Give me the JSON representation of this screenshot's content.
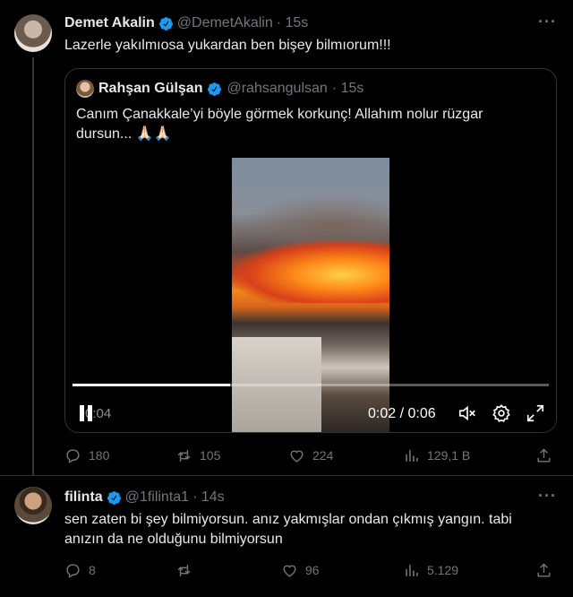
{
  "tweet1": {
    "author_name": "Demet Akalin",
    "handle": "@DemetAkalin",
    "time": "· 15s",
    "more": "···",
    "text": "Lazerle yakılmıosa yukardan ben bişey bilmıorum!!!",
    "quote": {
      "author_name": "Rahşan Gülşan",
      "handle": "@rahsangulsan",
      "time": "· 15s",
      "text": "Canım Çanakkale’yi böyle görmek korkunç! Allahım nolur rüzgar dursun... 🙏🏻🙏🏻",
      "video": {
        "current_time": "0:02 / 0:06",
        "left_time": "0:04",
        "progress": 0.33
      }
    },
    "actions": {
      "replies": "180",
      "retweets": "105",
      "likes": "224",
      "views": "129,1 B"
    }
  },
  "tweet2": {
    "author_name": "filinta",
    "handle": "@1filinta1",
    "time": "· 14s",
    "more": "···",
    "text": "sen zaten bi şey bilmiyorsun. anız yakmışlar ondan çıkmış yangın. tabi anızın da ne olduğunu bilmiyorsun",
    "actions": {
      "replies": "8",
      "retweets": "",
      "likes": "96",
      "views": "5.129"
    }
  },
  "colors": {
    "verified": "#1d9bf0",
    "muted": "#71767b",
    "border": "#2f3336"
  }
}
